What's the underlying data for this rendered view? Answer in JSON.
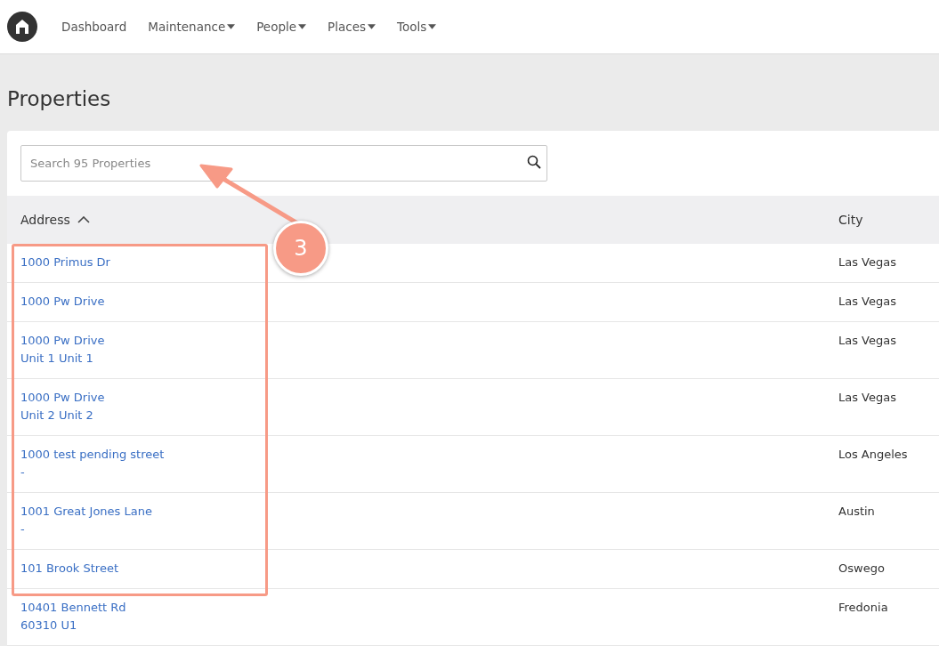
{
  "nav": {
    "items": [
      {
        "label": "Dashboard",
        "dropdown": false
      },
      {
        "label": "Maintenance",
        "dropdown": true
      },
      {
        "label": "People",
        "dropdown": true
      },
      {
        "label": "Places",
        "dropdown": true
      },
      {
        "label": "Tools",
        "dropdown": true
      }
    ]
  },
  "page_title": "Properties",
  "search": {
    "placeholder": "Search 95 Properties"
  },
  "table": {
    "columns": [
      {
        "label": "Address",
        "sorted": true
      },
      {
        "label": "City",
        "sorted": false
      }
    ],
    "rows": [
      {
        "address": [
          "1000 Primus Dr"
        ],
        "city": "Las Vegas"
      },
      {
        "address": [
          "1000 Pw Drive"
        ],
        "city": "Las Vegas"
      },
      {
        "address": [
          "1000 Pw Drive",
          "Unit 1 Unit 1"
        ],
        "city": "Las Vegas"
      },
      {
        "address": [
          "1000 Pw Drive",
          "Unit 2 Unit 2"
        ],
        "city": "Las Vegas"
      },
      {
        "address": [
          "1000 test pending street",
          "-"
        ],
        "city": "Los Angeles"
      },
      {
        "address": [
          "1001 Great Jones Lane",
          "-"
        ],
        "city": "Austin"
      },
      {
        "address": [
          "101 Brook Street"
        ],
        "city": "Oswego"
      },
      {
        "address": [
          "10401 Bennett Rd",
          "60310 U1"
        ],
        "city": "Fredonia"
      }
    ]
  },
  "annotation": {
    "step": "3"
  }
}
